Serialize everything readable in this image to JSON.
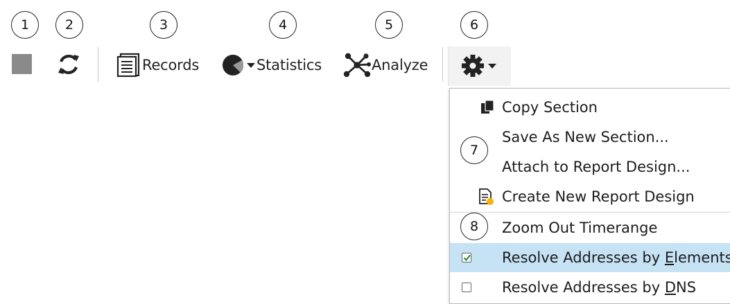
{
  "callouts": [
    "1",
    "2",
    "3",
    "4",
    "5",
    "6",
    "7",
    "8"
  ],
  "toolbar": {
    "stop_icon": "stop-square-icon",
    "refresh_icon": "refresh-icon",
    "records_label": "Records",
    "statistics_label": "Statistics",
    "analyze_label": "Analyze",
    "settings_icon": "gear-icon"
  },
  "menu": {
    "copy_section": "Copy Section",
    "save_as_new_section": "Save As New Section...",
    "attach_to_report_design": "Attach to Report Design...",
    "create_new_report_design": "Create New Report Design",
    "zoom_out_timerange": "Zoom Out Timerange",
    "resolve_by_elements_prefix": "Resolve Addresses by ",
    "resolve_by_elements_accel": "E",
    "resolve_by_elements_suffix": "lements",
    "resolve_by_elements_checked": true,
    "resolve_by_dns_prefix": "Resolve Addresses by ",
    "resolve_by_dns_accel": "D",
    "resolve_by_dns_suffix": "NS",
    "resolve_by_dns_checked": false
  },
  "colors": {
    "selected_row": "#c6e2f5",
    "check_green": "#2e8b2e",
    "stop_gray": "#8a8a8a"
  }
}
